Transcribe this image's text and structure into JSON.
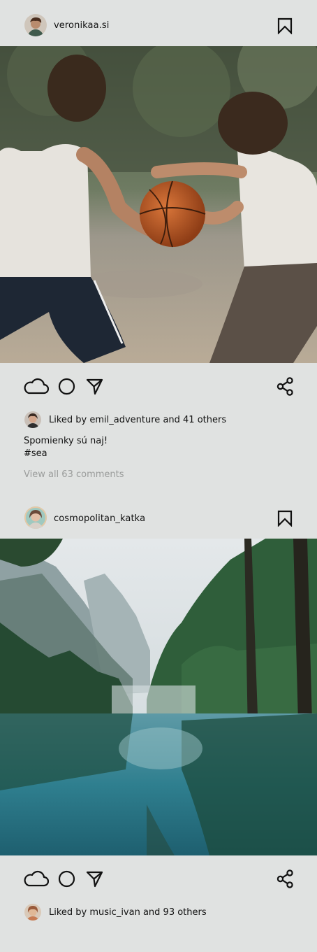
{
  "posts": [
    {
      "username": "veronikaa.si",
      "photo_description": "two boys playing basketball outdoors",
      "liked_by_user": "emil_adventure",
      "liked_text": "Liked by emil_adventure and 41 others",
      "caption_line1": "Spomienky sú naj!",
      "caption_line2": "#sea",
      "view_comments": "View all 63 comments"
    },
    {
      "username": "cosmopolitan_katka",
      "photo_description": "mountain lake with forest reflection",
      "liked_by_user": "music_ivan",
      "liked_text": "Liked by music_ivan and 93 others"
    }
  ],
  "icons": {
    "like": "cloud-icon",
    "comment": "circle-icon",
    "send": "send-icon",
    "share": "share-icon",
    "save": "bookmark-icon"
  },
  "colors": {
    "background": "#e0e2e1",
    "text": "#111111",
    "muted": "#9a9c9b"
  }
}
